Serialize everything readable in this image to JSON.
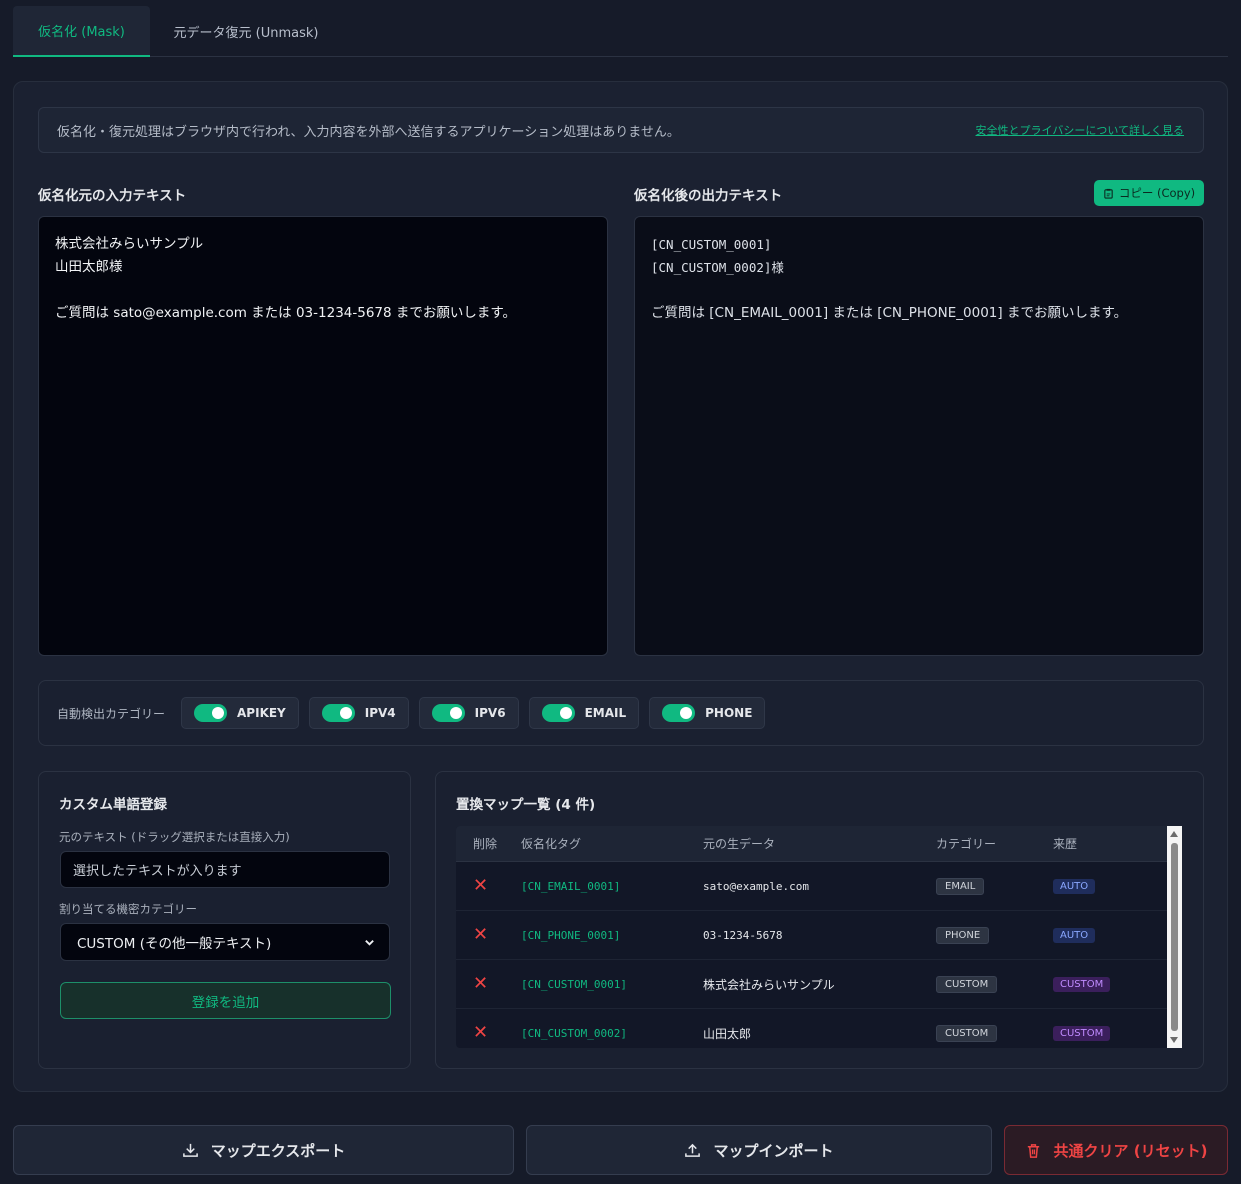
{
  "tabs": [
    {
      "label": "仮名化 (Mask)",
      "active": true
    },
    {
      "label": "元データ復元 (Unmask)",
      "active": false
    }
  ],
  "notice": {
    "text": "仮名化・復元処理はブラウザ内で行われ、入力内容を外部へ送信するアプリケーション処理はありません。",
    "link": "安全性とプライバシーについて詳しく見る"
  },
  "input_panel": {
    "title": "仮名化元の入力テキスト",
    "lines": [
      "株式会社みらいサンプル",
      "山田太郎様",
      "",
      "ご質問は sato@example.com または 03-1234-5678 までお願いします。"
    ]
  },
  "output_panel": {
    "title": "仮名化後の出力テキスト",
    "copy_label": "コピー (Copy)",
    "lines": [
      "[CN_CUSTOM_0001]",
      "[CN_CUSTOM_0002]様",
      "",
      "ご質問は [CN_EMAIL_0001] または [CN_PHONE_0001] までお願いします。"
    ]
  },
  "categories": {
    "label": "自動検出カテゴリー",
    "items": [
      {
        "label": "APIKEY",
        "on": true
      },
      {
        "label": "IPV4",
        "on": true
      },
      {
        "label": "IPV6",
        "on": true
      },
      {
        "label": "EMAIL",
        "on": true
      },
      {
        "label": "PHONE",
        "on": true
      }
    ]
  },
  "custom": {
    "title": "カスタム単語登録",
    "source_label": "元のテキスト (ドラッグ選択または直接入力)",
    "source_placeholder": "選択したテキストが入ります",
    "category_label": "割り当てる機密カテゴリー",
    "category_value": "CUSTOM (その他一般テキスト)",
    "add_label": "登録を追加"
  },
  "map": {
    "title": "置換マップ一覧 (4 件)",
    "headers": {
      "del": "削除",
      "tag": "仮名化タグ",
      "raw": "元の生データ",
      "cat": "カテゴリー",
      "src": "来歴"
    },
    "rows": [
      {
        "tag": "[CN_EMAIL_0001]",
        "raw": "sato@example.com",
        "cat": "EMAIL",
        "src": "AUTO"
      },
      {
        "tag": "[CN_PHONE_0001]",
        "raw": "03-1234-5678",
        "cat": "PHONE",
        "src": "AUTO"
      },
      {
        "tag": "[CN_CUSTOM_0001]",
        "raw": "株式会社みらいサンプル",
        "cat": "CUSTOM",
        "src": "CUSTOM"
      },
      {
        "tag": "[CN_CUSTOM_0002]",
        "raw": "山田太郎",
        "cat": "CUSTOM",
        "src": "CUSTOM"
      }
    ]
  },
  "buttons": {
    "export": "マップエクスポート",
    "import": "マップインポート",
    "clear": "共通クリア (リセット)"
  },
  "colors": {
    "accent": "#10b981",
    "danger": "#ef4444",
    "auto_badge": "#8aa7ff",
    "custom_badge": "#c08bff"
  }
}
